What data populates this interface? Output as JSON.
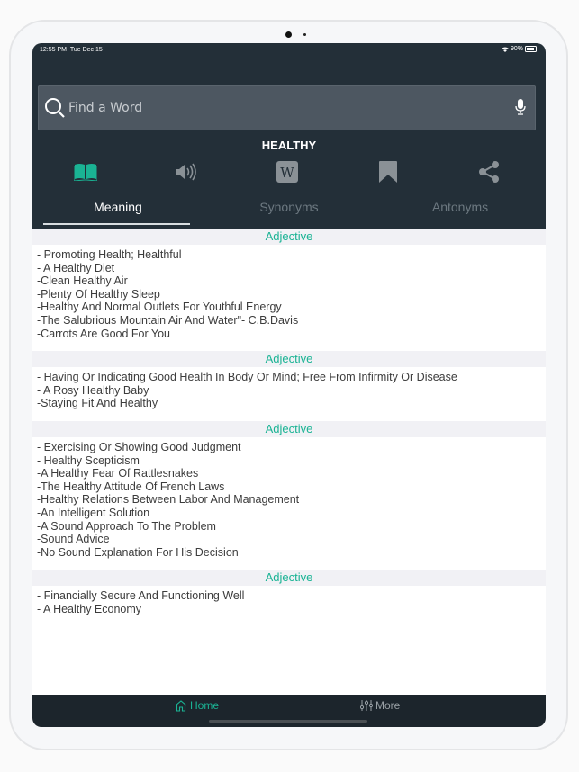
{
  "status_bar": {
    "time": "12:55 PM",
    "date": "Tue Dec 15",
    "battery": "90%"
  },
  "search": {
    "placeholder": "Find a Word"
  },
  "word": "HEALTHY",
  "action_icons": [
    {
      "name": "book-icon",
      "active": true
    },
    {
      "name": "speaker-icon",
      "active": false
    },
    {
      "name": "wikipedia-icon",
      "active": false
    },
    {
      "name": "bookmark-icon",
      "active": false
    },
    {
      "name": "share-icon",
      "active": false
    }
  ],
  "tabs": [
    {
      "label": "Meaning",
      "active": true
    },
    {
      "label": "Synonyms",
      "active": false
    },
    {
      "label": "Antonyms",
      "active": false
    }
  ],
  "sections": [
    {
      "pos": "Adjective",
      "lines": [
        "- Promoting Health; Healthful",
        "- A Healthy Diet",
        "-Clean Healthy Air",
        "-Plenty Of Healthy Sleep",
        "-Healthy And Normal Outlets For Youthful Energy",
        "-The Salubrious Mountain Air And Water\"- C.B.Davis",
        "-Carrots Are Good For You"
      ]
    },
    {
      "pos": "Adjective",
      "lines": [
        "- Having Or Indicating Good Health In Body Or Mind; Free From Infirmity Or Disease",
        "- A Rosy Healthy Baby",
        "-Staying Fit And Healthy"
      ]
    },
    {
      "pos": "Adjective",
      "lines": [
        "- Exercising Or Showing Good Judgment",
        "- Healthy Scepticism",
        "-A Healthy Fear Of Rattlesnakes",
        "-The Healthy Attitude Of French Laws",
        "-Healthy Relations Between Labor And Management",
        "-An Intelligent Solution",
        "-A Sound Approach To The Problem",
        "-Sound Advice",
        "-No Sound Explanation For His Decision"
      ]
    },
    {
      "pos": "Adjective",
      "lines": [
        "- Financially Secure And Functioning Well",
        "- A Healthy Economy"
      ]
    }
  ],
  "bottom_tabs": [
    {
      "label": "Home",
      "icon": "home-icon",
      "active": true
    },
    {
      "label": "More",
      "icon": "sliders-icon",
      "active": false
    }
  ],
  "colors": {
    "accent": "#1ab394",
    "header_bg": "#232f38",
    "tabbar_bg": "#1c252c",
    "section_bg": "#f1f1f5"
  }
}
